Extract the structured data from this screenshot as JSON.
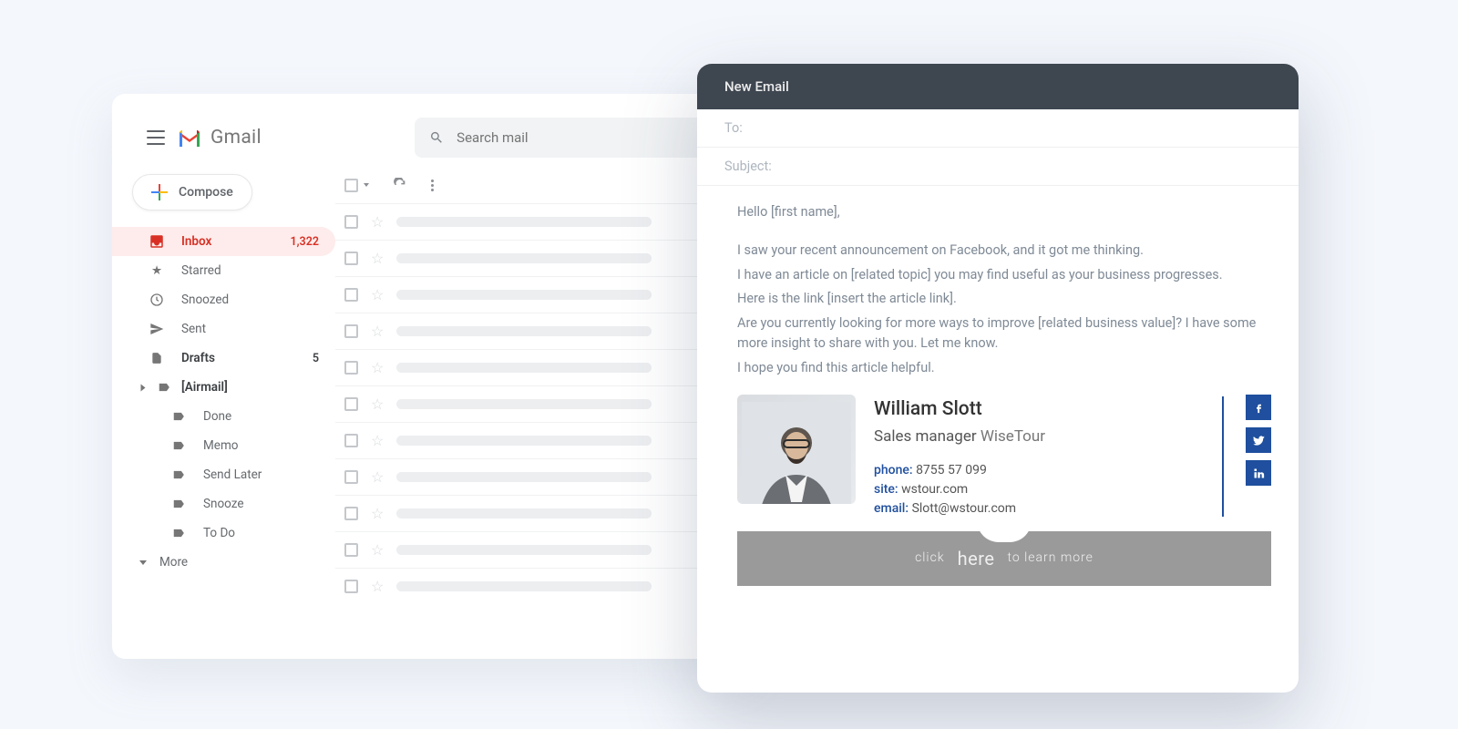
{
  "gmail": {
    "app_name": "Gmail",
    "search_placeholder": "Search mail",
    "compose_label": "Compose",
    "nav": {
      "inbox": {
        "label": "Inbox",
        "count": "1,322"
      },
      "starred": {
        "label": "Starred"
      },
      "snoozed": {
        "label": "Snoozed"
      },
      "sent": {
        "label": "Sent"
      },
      "drafts": {
        "label": "Drafts",
        "count": "5"
      },
      "airmail": {
        "label": "[Airmail]"
      },
      "children": [
        {
          "label": "Done"
        },
        {
          "label": "Memo"
        },
        {
          "label": "Send Later"
        },
        {
          "label": "Snooze"
        },
        {
          "label": "To Do"
        }
      ],
      "more": "More"
    }
  },
  "compose": {
    "title": "New Email",
    "to_label": "To:",
    "subject_label": "Subject:",
    "body": {
      "greeting": "Hello [first name],",
      "p1": "I saw your recent announcement on Facebook, and it got me thinking.",
      "p2": "I have an article on [related topic] you may find useful as your business progresses.",
      "p3": "Here is the link [insert the article link].",
      "p4": "Are you currently looking for more ways to improve [related business value]? I have some more insight to share with you. Let me know.",
      "p5": "I hope you find this article helpful."
    },
    "signature": {
      "name": "William Slott",
      "role": "Sales manager",
      "company": "WiseTour",
      "phone_label": "phone:",
      "phone": "8755 57 099",
      "site_label": "site:",
      "site": "wstour.com",
      "email_label": "email:",
      "email": "Slott@wstour.com"
    },
    "banner": {
      "pre": "click",
      "mid": "here",
      "post": "to learn more"
    }
  }
}
